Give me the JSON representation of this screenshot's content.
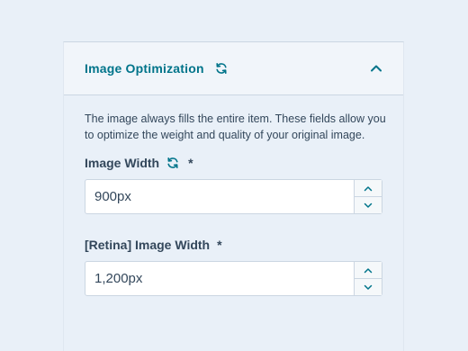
{
  "section": {
    "title": "Image Optimization",
    "description": "The image always fills the entire item. These fields allow you to optimize the weight and quality of your original image."
  },
  "fields": [
    {
      "label": "Image Width",
      "required_mark": "*",
      "value": "900px",
      "has_sync_icon": true
    },
    {
      "label": "[Retina] Image Width",
      "required_mark": "*",
      "value": "1,200px",
      "has_sync_icon": false
    }
  ],
  "icons": {
    "sync": "refresh-icon",
    "collapse": "chevron-up-icon",
    "increment": "chevron-up-icon",
    "decrement": "chevron-down-icon"
  },
  "colors": {
    "accent": "#00748a",
    "text": "#33475b",
    "border": "#cbd6e2",
    "background": "#e9f0f8",
    "header_bg": "#f1f5fa"
  }
}
